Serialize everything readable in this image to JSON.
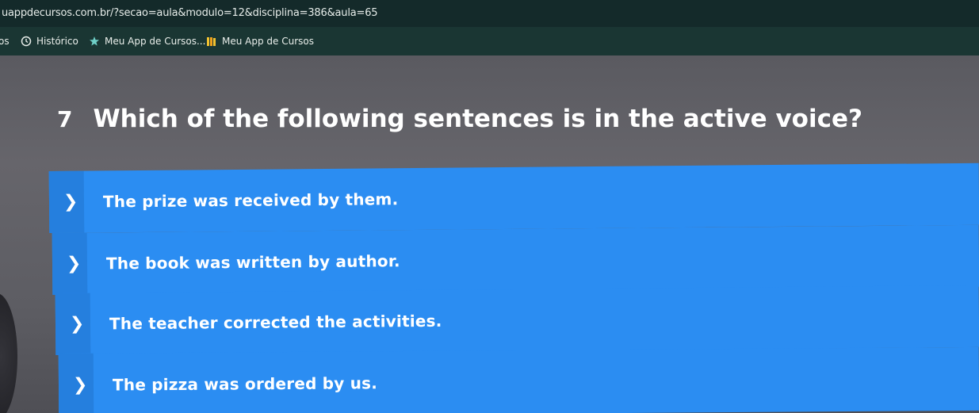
{
  "browser": {
    "url": "uappdecursos.com.br/?secao=aula&modulo=12&disciplina=386&aula=65",
    "bookmarks": [
      {
        "label": "os",
        "icon": "none"
      },
      {
        "label": "Histórico",
        "icon": "history-icon"
      },
      {
        "label": "Meu App de Cursos...",
        "icon": "star-icon"
      },
      {
        "label": "Meu App de Cursos",
        "icon": "book-icon"
      }
    ]
  },
  "quiz": {
    "question_number": "7",
    "question": "Which of the following sentences is in the active voice?",
    "options": [
      {
        "text": "The prize was received by them."
      },
      {
        "text": "The book was written by author."
      },
      {
        "text": "The teacher corrected the activities."
      },
      {
        "text": "The pizza was ordered by us."
      }
    ]
  },
  "colors": {
    "option_bg": "#2b8df2",
    "option_handle": "#257fde",
    "browser_bar": "#142a2a"
  }
}
